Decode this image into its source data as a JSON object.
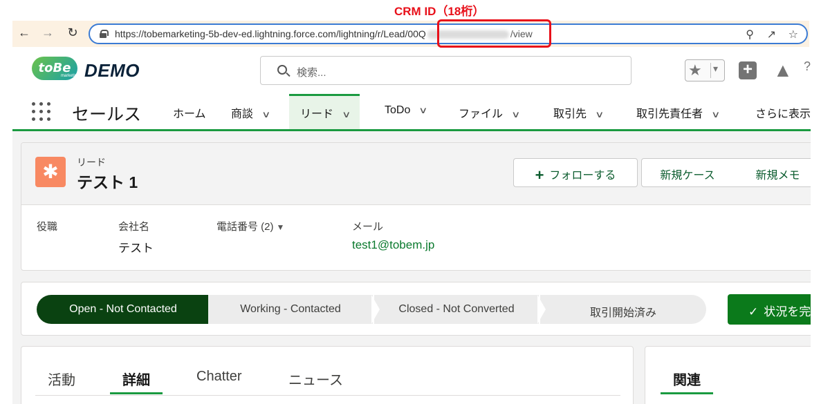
{
  "annotation": {
    "label": "CRM ID（18桁）",
    "color": "#e8101a"
  },
  "browser": {
    "url_prefix": "https://tobemarketing-5b-dev-ed.lightning.force.com/lightning/r/Lead/00Q",
    "url_suffix": "/view",
    "back_icon": "arrow-left-icon",
    "forward_icon": "arrow-right-icon",
    "reload_icon": "reload-icon"
  },
  "header": {
    "logo_text": "toBe",
    "logo_sub": "marketing",
    "brand": "DEMO",
    "search_placeholder": "検索..."
  },
  "nav": {
    "app_name": "セールス",
    "items": [
      {
        "label": "ホーム"
      },
      {
        "label": "商談"
      },
      {
        "label": "リード"
      },
      {
        "label": "ToDo"
      },
      {
        "label": "ファイル"
      },
      {
        "label": "取引先"
      },
      {
        "label": "取引先責任者"
      },
      {
        "label": "さらに表示"
      }
    ],
    "accent": "#1a9a40"
  },
  "record": {
    "type": "リード",
    "title": "テスト 1",
    "buttons": {
      "follow": "フォローする",
      "new_case": "新規ケース",
      "new_note": "新規メモ"
    },
    "fields": {
      "role_label": "役職",
      "company_label": "会社名",
      "company_value": "テスト",
      "phone_label": "電話番号 (2)",
      "email_label": "メール",
      "email_value": "test1@tobem.jp"
    }
  },
  "path": {
    "steps": [
      {
        "label": "Open - Not Contacted",
        "active": true
      },
      {
        "label": "Working - Contacted"
      },
      {
        "label": "Closed - Not Converted"
      },
      {
        "label": "取引開始済み"
      }
    ],
    "status_button": "状況を完"
  },
  "tabs": {
    "items": [
      {
        "label": "活動"
      },
      {
        "label": "詳細"
      },
      {
        "label": "Chatter"
      },
      {
        "label": "ニュース"
      }
    ],
    "related": "関連"
  }
}
